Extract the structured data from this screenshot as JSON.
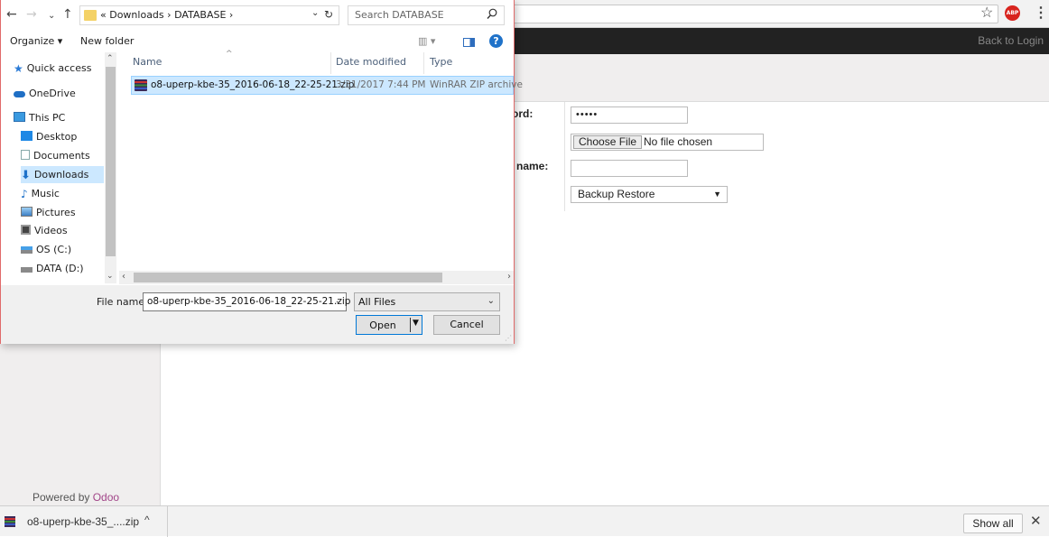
{
  "browser": {
    "star_icon": "star-icon",
    "abp_badge": "ABP",
    "menu_icon": "kebab-menu-icon"
  },
  "odoo": {
    "back_to_login": "Back to Login",
    "form": {
      "password_label": "ord:",
      "password_value": "•••••",
      "choose_file_label": "Choose File",
      "no_file_text": "No file chosen",
      "name_label": "name:",
      "name_value": "",
      "mode_value": "Backup Restore"
    },
    "powered_by": "Powered by",
    "powered_by_brand": "Odoo",
    "brand_color": "#a24689"
  },
  "downloads": {
    "item_name": "o8-uperp-kbe-35_....zip",
    "show_all": "Show all"
  },
  "dialog": {
    "address": {
      "prefix": "«",
      "parent": "Downloads",
      "current": "DATABASE",
      "separator": "›"
    },
    "search_placeholder": "Search DATABASE",
    "toolbar": {
      "organize": "Organize ▾",
      "new_folder": "New folder"
    },
    "nav_items": [
      {
        "label": "Quick access",
        "icon": "star-pin-icon"
      },
      {
        "label": "OneDrive",
        "icon": "cloud-icon"
      },
      {
        "label": "This PC",
        "icon": "monitor-icon"
      },
      {
        "label": "Desktop",
        "icon": "desktop-icon"
      },
      {
        "label": "Documents",
        "icon": "documents-icon"
      },
      {
        "label": "Downloads",
        "icon": "download-arrow-icon"
      },
      {
        "label": "Music",
        "icon": "music-note-icon"
      },
      {
        "label": "Pictures",
        "icon": "pictures-icon"
      },
      {
        "label": "Videos",
        "icon": "film-icon"
      },
      {
        "label": "OS (C:)",
        "icon": "drive-os-icon"
      },
      {
        "label": "DATA (D:)",
        "icon": "drive-icon"
      }
    ],
    "columns": {
      "name": "Name",
      "date_modified": "Date modified",
      "type": "Type"
    },
    "files": [
      {
        "name": "o8-uperp-kbe-35_2016-06-18_22-25-21.zip",
        "date": "3/31/2017 7:44 PM",
        "type": "WinRAR ZIP archive"
      }
    ],
    "file_name_label": "File name:",
    "file_name_value": "o8-uperp-kbe-35_2016-06-18_22-25-21.zip",
    "filter_value": "All Files",
    "open_label": "Open",
    "cancel_label": "Cancel"
  },
  "colors": {
    "selection_bg": "#cce8ff",
    "dialog_border": "#e06a6a",
    "odoo_topbar": "#222222"
  }
}
